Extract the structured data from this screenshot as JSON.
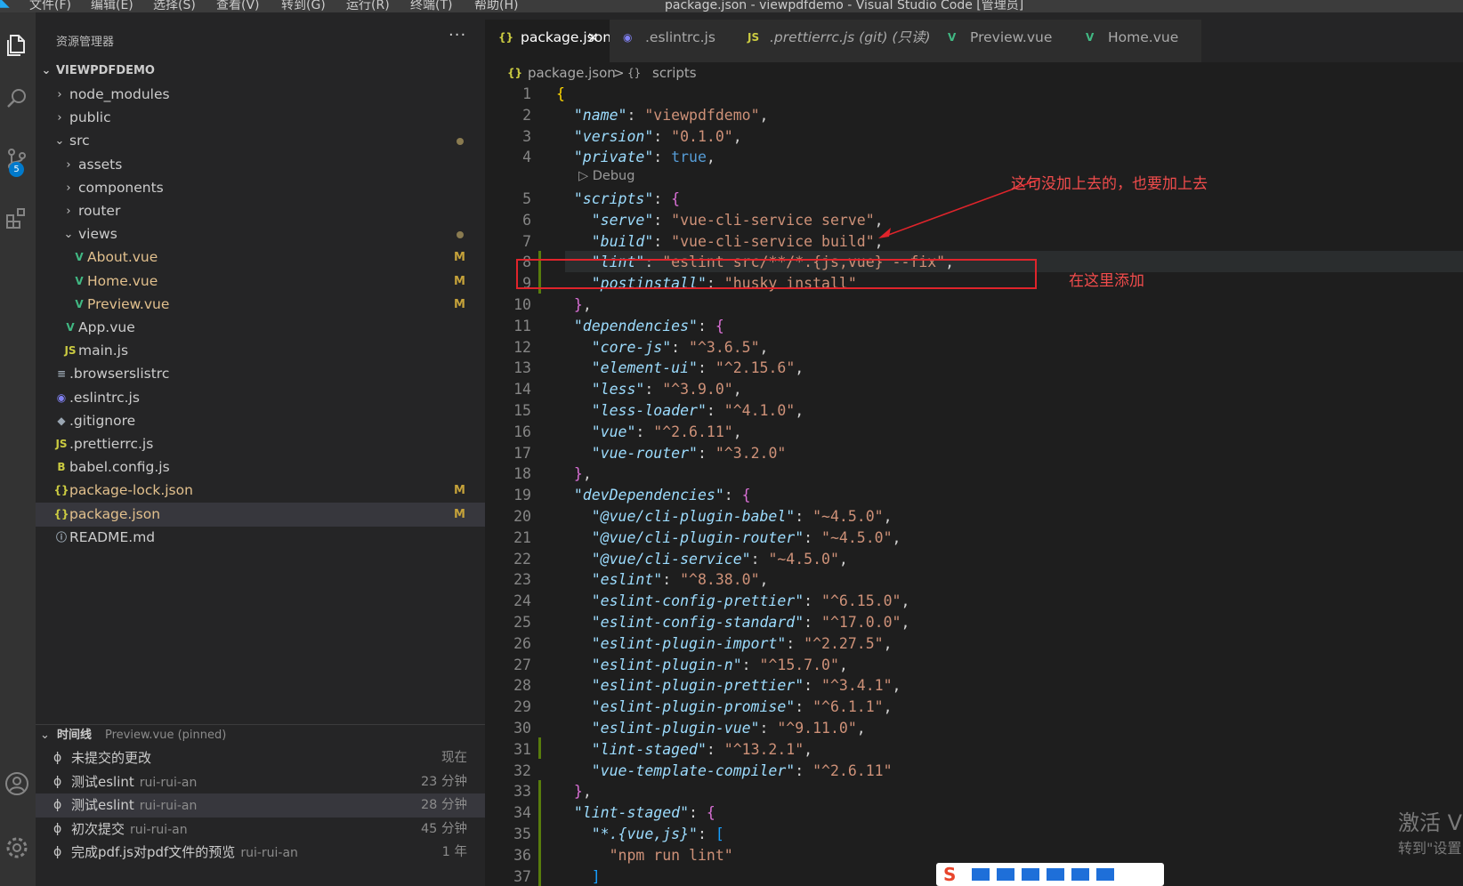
{
  "menu": [
    "文件(F)",
    "编辑(E)",
    "选择(S)",
    "查看(V)",
    "转到(G)",
    "运行(R)",
    "终端(T)",
    "帮助(H)"
  ],
  "window_title": "package.json - viewpdfdemo - Visual Studio Code [管理员]",
  "activity": {
    "scm_badge": "5"
  },
  "explorer": {
    "header": "资源管理器",
    "more": "···",
    "project": "VIEWPDFDEMO",
    "items": [
      {
        "label": "node_modules",
        "type": "folder",
        "expanded": false,
        "depth": 0
      },
      {
        "label": "public",
        "type": "folder",
        "expanded": false,
        "depth": 0
      },
      {
        "label": "src",
        "type": "folder",
        "expanded": true,
        "depth": 0,
        "dot": true
      },
      {
        "label": "assets",
        "type": "folder",
        "expanded": false,
        "depth": 1
      },
      {
        "label": "components",
        "type": "folder",
        "expanded": false,
        "depth": 1
      },
      {
        "label": "router",
        "type": "folder",
        "expanded": false,
        "depth": 1
      },
      {
        "label": "views",
        "type": "folder",
        "expanded": true,
        "depth": 1,
        "dot": true
      },
      {
        "label": "About.vue",
        "type": "vue",
        "depth": 2,
        "status": "M"
      },
      {
        "label": "Home.vue",
        "type": "vue",
        "depth": 2,
        "status": "M"
      },
      {
        "label": "Preview.vue",
        "type": "vue",
        "depth": 2,
        "status": "M"
      },
      {
        "label": "App.vue",
        "type": "vue",
        "depth": 1
      },
      {
        "label": "main.js",
        "type": "js",
        "depth": 1
      },
      {
        "label": ".browserslistrc",
        "type": "list",
        "depth": 0
      },
      {
        "label": ".eslintrc.js",
        "type": "eslint",
        "depth": 0
      },
      {
        "label": ".gitignore",
        "type": "git",
        "depth": 0
      },
      {
        "label": ".prettierrc.js",
        "type": "js",
        "depth": 0
      },
      {
        "label": "babel.config.js",
        "type": "babel",
        "depth": 0
      },
      {
        "label": "package-lock.json",
        "type": "json",
        "depth": 0,
        "status": "M"
      },
      {
        "label": "package.json",
        "type": "json",
        "depth": 0,
        "status": "M",
        "selected": true
      },
      {
        "label": "README.md",
        "type": "info",
        "depth": 0
      }
    ]
  },
  "timeline": {
    "title": "时间线",
    "pinned": "Preview.vue (pinned)",
    "entries": [
      {
        "label": "未提交的更改",
        "author": "",
        "time": "现在"
      },
      {
        "label": "测试eslint",
        "author": "rui-rui-an",
        "time": "23 分钟"
      },
      {
        "label": "测试eslint",
        "author": "rui-rui-an",
        "time": "28 分钟",
        "selected": true
      },
      {
        "label": "初次提交",
        "author": "rui-rui-an",
        "time": "45 分钟"
      },
      {
        "label": "完成pdf.js对pdf文件的预览",
        "author": "rui-rui-an",
        "time": "1 年"
      }
    ]
  },
  "tabs": [
    {
      "label": "package.json",
      "icon": "{}",
      "active": true,
      "close": "×"
    },
    {
      "label": ".eslintrc.js",
      "icon": "◉"
    },
    {
      "label": ".prettierrc.js (git) (只读)",
      "icon": "JS"
    },
    {
      "label": "Preview.vue",
      "icon": "V"
    },
    {
      "label": "Home.vue",
      "icon": "V"
    }
  ],
  "breadcrumb": {
    "file": "package.json",
    "sep": ">",
    "symbol": "scripts",
    "file_icon": "{}",
    "symbol_icon": "{}"
  },
  "codelens": "▷ Debug",
  "code_lines": [
    {
      "n": "1",
      "t": "{"
    },
    {
      "n": "2",
      "t": "  \"name\": \"viewpdfdemo\","
    },
    {
      "n": "3",
      "t": "  \"version\": \"0.1.0\","
    },
    {
      "n": "4",
      "t": "  \"private\": true,"
    },
    {
      "n": "5",
      "t": "  \"scripts\": {"
    },
    {
      "n": "6",
      "t": "    \"serve\": \"vue-cli-service serve\","
    },
    {
      "n": "7",
      "t": "    \"build\": \"vue-cli-service build\","
    },
    {
      "n": "8",
      "t": "    \"lint\": \"eslint src/**/*.{js,vue} --fix\","
    },
    {
      "n": "9",
      "t": "    \"postinstall\": \"husky install\""
    },
    {
      "n": "10",
      "t": "  },"
    },
    {
      "n": "11",
      "t": "  \"dependencies\": {"
    },
    {
      "n": "12",
      "t": "    \"core-js\": \"^3.6.5\","
    },
    {
      "n": "13",
      "t": "    \"element-ui\": \"^2.15.6\","
    },
    {
      "n": "14",
      "t": "    \"less\": \"^3.9.0\","
    },
    {
      "n": "15",
      "t": "    \"less-loader\": \"^4.1.0\","
    },
    {
      "n": "16",
      "t": "    \"vue\": \"^2.6.11\","
    },
    {
      "n": "17",
      "t": "    \"vue-router\": \"^3.2.0\""
    },
    {
      "n": "18",
      "t": "  },"
    },
    {
      "n": "19",
      "t": "  \"devDependencies\": {"
    },
    {
      "n": "20",
      "t": "    \"@vue/cli-plugin-babel\": \"~4.5.0\","
    },
    {
      "n": "21",
      "t": "    \"@vue/cli-plugin-router\": \"~4.5.0\","
    },
    {
      "n": "22",
      "t": "    \"@vue/cli-service\": \"~4.5.0\","
    },
    {
      "n": "23",
      "t": "    \"eslint\": \"^8.38.0\","
    },
    {
      "n": "24",
      "t": "    \"eslint-config-prettier\": \"^6.15.0\","
    },
    {
      "n": "25",
      "t": "    \"eslint-config-standard\": \"^17.0.0\","
    },
    {
      "n": "26",
      "t": "    \"eslint-plugin-import\": \"^2.27.5\","
    },
    {
      "n": "27",
      "t": "    \"eslint-plugin-n\": \"^15.7.0\","
    },
    {
      "n": "28",
      "t": "    \"eslint-plugin-prettier\": \"^3.4.1\","
    },
    {
      "n": "29",
      "t": "    \"eslint-plugin-promise\": \"^6.1.1\","
    },
    {
      "n": "30",
      "t": "    \"eslint-plugin-vue\": \"^9.11.0\","
    },
    {
      "n": "31",
      "t": "    \"lint-staged\": \"^13.2.1\","
    },
    {
      "n": "32",
      "t": "    \"vue-template-compiler\": \"^2.6.11\""
    },
    {
      "n": "33",
      "t": "  },"
    },
    {
      "n": "34",
      "t": "  \"lint-staged\": {"
    },
    {
      "n": "35",
      "t": "    \"*.{vue,js}\": ["
    },
    {
      "n": "36",
      "t": "      \"npm run lint\""
    },
    {
      "n": "37",
      "t": "    ]"
    }
  ],
  "annotations": {
    "note1": "这句没加上去的，也要加上去",
    "note2": "在这里添加",
    "color": "#e0242b"
  },
  "watermark": {
    "line1": "激活 V",
    "line2": "转到\"设置"
  },
  "colors": {
    "accent": "#007acc",
    "key": "#9cdcfe",
    "string": "#ce9178",
    "vue": "#41b883",
    "modified": "#e2c08d"
  }
}
